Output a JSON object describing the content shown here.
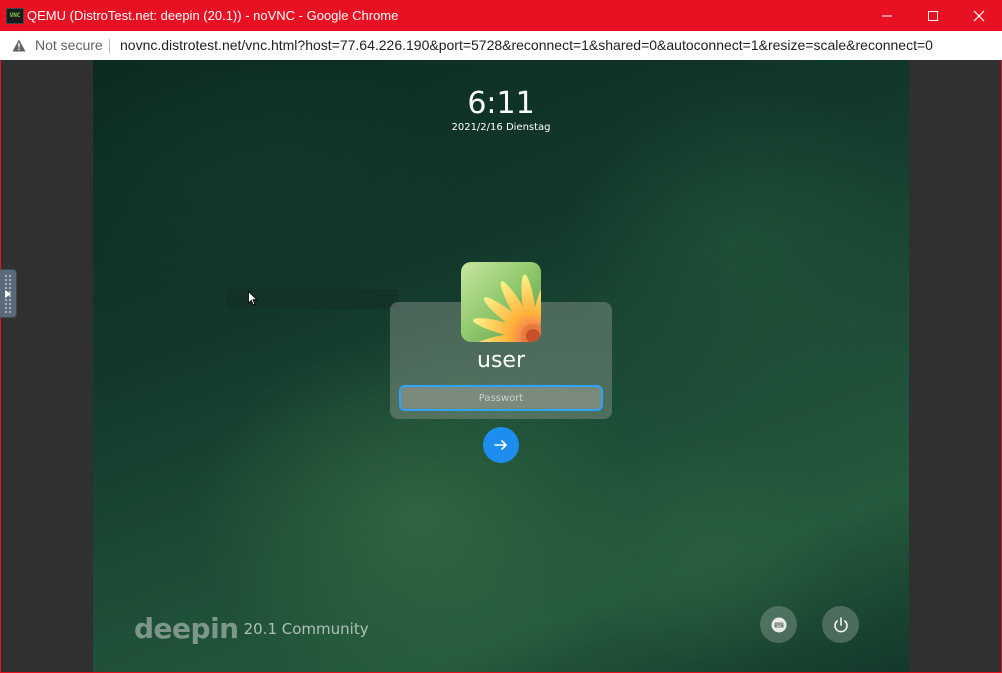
{
  "window": {
    "title": "QEMU (DistroTest.net: deepin (20.1)) - noVNC - Google Chrome",
    "app_icon_text": "VNC",
    "controls": [
      "minimize-icon",
      "maximize-icon",
      "close-icon"
    ]
  },
  "address_bar": {
    "security_label": "Not secure",
    "security_icon": "warning-icon",
    "url": "novnc.distrotest.net/vnc.html?host=77.64.226.190&port=5728&reconnect=1&shared=0&autoconnect=1&resize=scale&reconnect=0"
  },
  "lock_screen": {
    "time": "6:11",
    "date": "2021/2/16 Dienstag",
    "user": {
      "name": "user",
      "avatar": "flower-avatar"
    },
    "password": {
      "value": "",
      "placeholder": "Passwort"
    },
    "submit_icon": "arrow-right-icon",
    "branding": {
      "logo": "deepin",
      "edition": "20.1 Community"
    },
    "bottom_buttons": [
      "keyboard-icon",
      "power-icon"
    ]
  },
  "novnc": {
    "control_handle_icon": "expand-arrow-icon"
  },
  "colors": {
    "titlebar": "#e81123",
    "submit_button": "#1d8df0",
    "input_focus_border": "#2ea4ff"
  }
}
